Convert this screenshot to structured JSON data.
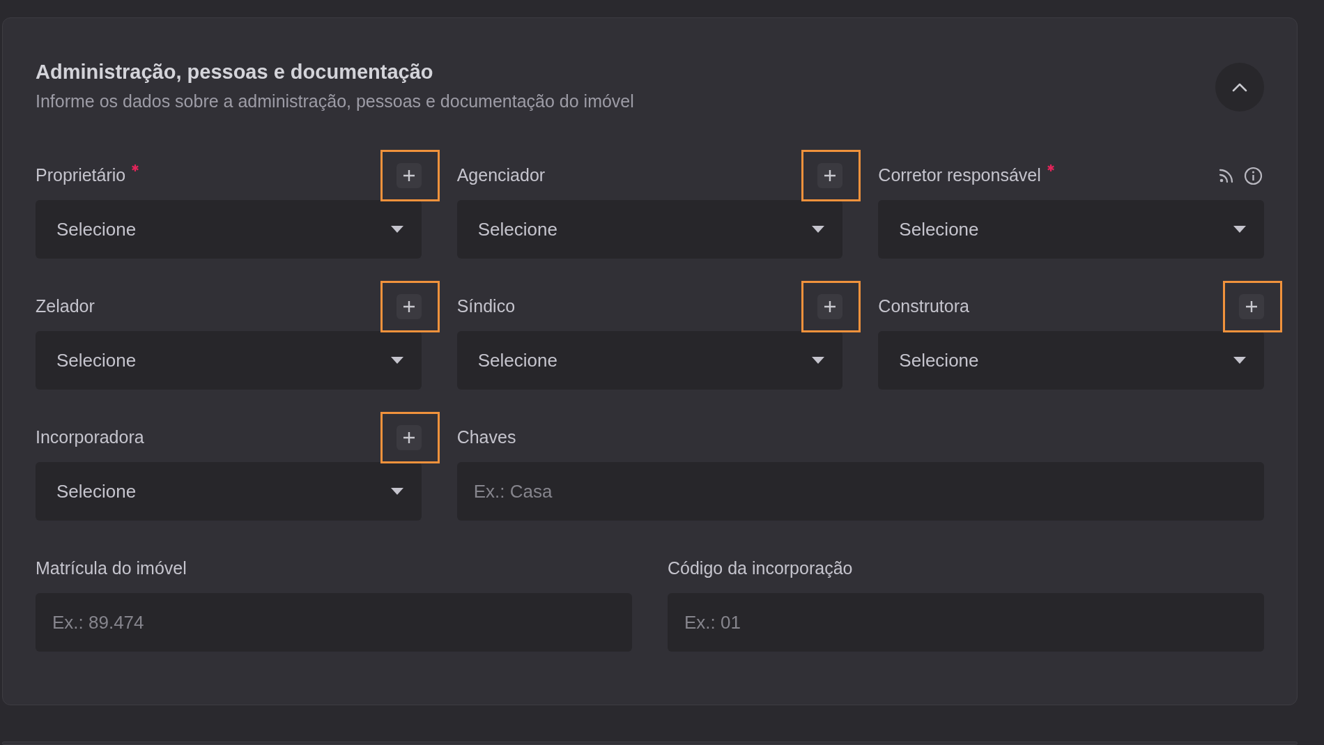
{
  "section": {
    "title": "Administração, pessoas e documentação",
    "subtitle": "Informe os dados sobre a administração, pessoas e documentação do imóvel",
    "expanded": true
  },
  "grid_fields": [
    {
      "kind": "select",
      "label": "Proprietário",
      "required": true,
      "value": "Selecione",
      "add_button": {
        "highlighted": true
      }
    },
    {
      "kind": "select",
      "label": "Agenciador",
      "required": false,
      "value": "Selecione",
      "add_button": {
        "highlighted": true
      }
    },
    {
      "kind": "select",
      "label": "Corretor responsável",
      "required": true,
      "value": "Selecione",
      "extra_icons": true
    },
    {
      "kind": "select",
      "label": "Zelador",
      "required": false,
      "value": "Selecione",
      "add_button": {
        "highlighted": true
      }
    },
    {
      "kind": "select",
      "label": "Síndico",
      "required": false,
      "value": "Selecione",
      "add_button": {
        "highlighted": true
      }
    },
    {
      "kind": "select",
      "label": "Construtora",
      "required": false,
      "value": "Selecione",
      "add_button": {
        "highlighted": true
      }
    },
    {
      "kind": "select",
      "label": "Incorporadora",
      "required": false,
      "value": "Selecione",
      "add_button": {
        "highlighted": true
      }
    },
    {
      "kind": "text",
      "label": "Chaves",
      "required": false,
      "placeholder": "Ex.: Casa"
    }
  ],
  "bottom_fields": [
    {
      "kind": "text",
      "label": "Matrícula do imóvel",
      "required": false,
      "placeholder": "Ex.: 89.474"
    },
    {
      "kind": "text",
      "label": "Código da incorporação",
      "required": false,
      "placeholder": "Ex.: 01"
    }
  ]
}
